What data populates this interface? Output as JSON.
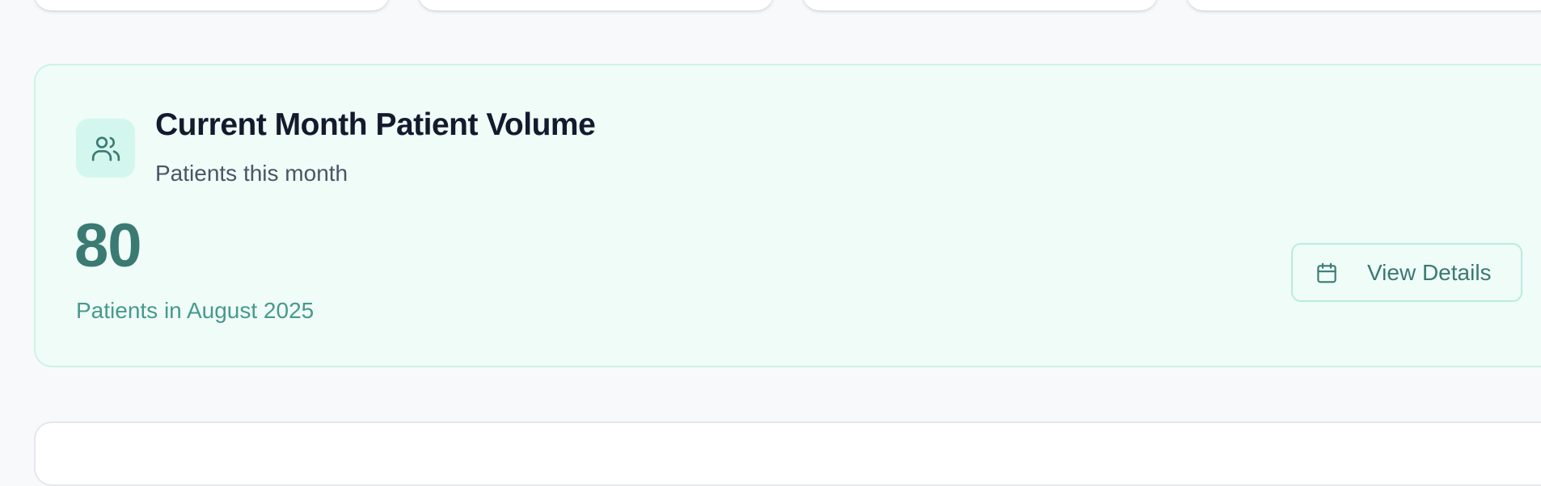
{
  "colors": {
    "page_background": "#f8f9fb",
    "card_background": "#effcf8",
    "card_border": "#cdf2e8",
    "accent": "#3a7a72",
    "accent_light": "#48998d",
    "icon_background": "#d3f7ef",
    "title": "#141a2e",
    "subtitle": "#4a5565"
  },
  "patient_volume_card": {
    "icon": "users-icon",
    "title": "Current Month Patient Volume",
    "subtitle": "Patients this month",
    "value": "80",
    "caption": "Patients in August 2025",
    "button": {
      "icon": "calendar-icon",
      "label": "View Details"
    }
  }
}
